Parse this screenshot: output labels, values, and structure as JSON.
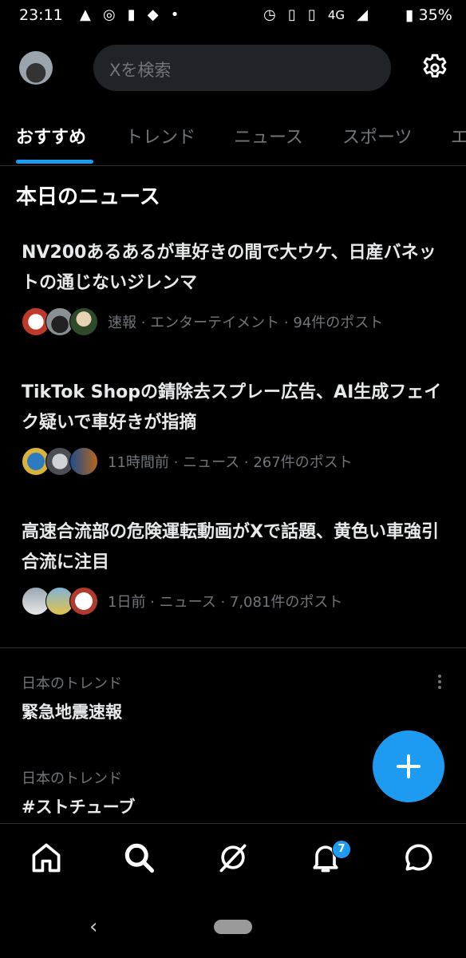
{
  "status_bar": {
    "time": "23:11",
    "left_icons": [
      "alert-icon",
      "circle-icon",
      "sd-card-icon",
      "shield-alert-icon",
      "dot-icon"
    ],
    "right_icons": [
      "alarm-icon",
      "vibrate-icon",
      "network-4g-icon",
      "signal-icon",
      "battery-icon"
    ],
    "network": "4G",
    "battery": "35%"
  },
  "header": {
    "search_placeholder": "Xを検索"
  },
  "tabs": [
    {
      "label": "おすすめ",
      "active": true
    },
    {
      "label": "トレンド",
      "active": false
    },
    {
      "label": "ニュース",
      "active": false
    },
    {
      "label": "スポーツ",
      "active": false
    },
    {
      "label": "エ",
      "active": false
    }
  ],
  "section_title": "本日のニュース",
  "news": [
    {
      "headline": "NV200あるあるが車好きの間で大ウケ、日産バネットの通じないジレンマ",
      "meta": "速報 · エンターテイメント · 94件のポスト"
    },
    {
      "headline": "TikTok Shopの錆除去スプレー広告、AI生成フェイク疑いで車好きが指摘",
      "meta": "11時間前 · ニュース · 267件のポスト"
    },
    {
      "headline": "高速合流部の危険運転動画がXで話題、黄色い車強引合流に注目",
      "meta": "1日前 · ニュース · 7,081件のポスト"
    }
  ],
  "trends": [
    {
      "label": "日本のトレンド",
      "title": "緊急地震速報"
    },
    {
      "label": "日本のトレンド",
      "title": "#ストチューブ"
    }
  ],
  "bottom_nav": {
    "items": [
      "home-icon",
      "search-icon",
      "grok-icon",
      "bell-icon",
      "messages-icon"
    ],
    "notification_count": "7"
  },
  "colors": {
    "accent": "#1d9bf0",
    "background": "#000000",
    "secondary_text": "#71767b"
  }
}
